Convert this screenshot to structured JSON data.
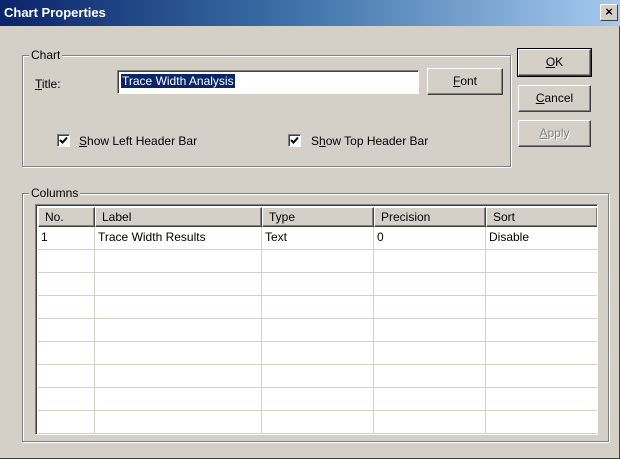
{
  "window": {
    "title": "Chart Properties",
    "close_glyph": "×"
  },
  "chart_group": {
    "label": "Chart",
    "title_label_prefix": "",
    "title_label_u": "T",
    "title_label_rest": "itle:",
    "title_value": "Trace Width Analysis",
    "font_button": {
      "u": "F",
      "rest": "ont"
    },
    "show_left_header_bar": {
      "checked": true,
      "u": "S",
      "rest": "how Left Header Bar"
    },
    "show_top_header_bar": {
      "checked": true,
      "pre": "S",
      "u": "h",
      "rest": "ow Top Header Bar"
    }
  },
  "buttons": {
    "ok": {
      "u": "O",
      "rest": "K"
    },
    "cancel": {
      "u": "C",
      "rest": "ancel"
    },
    "apply": {
      "u": "A",
      "rest": "pply",
      "disabled": true
    }
  },
  "columns_group": {
    "label": "Columns",
    "headers": [
      "No.",
      "Label",
      "Type",
      "Precision",
      "Sort"
    ],
    "rows": [
      [
        "1",
        "Trace Width Results",
        "Text",
        "0",
        "Disable"
      ],
      [
        "",
        "",
        "",
        "",
        ""
      ],
      [
        "",
        "",
        "",
        "",
        ""
      ],
      [
        "",
        "",
        "",
        "",
        ""
      ],
      [
        "",
        "",
        "",
        "",
        ""
      ],
      [
        "",
        "",
        "",
        "",
        ""
      ],
      [
        "",
        "",
        "",
        "",
        ""
      ],
      [
        "",
        "",
        "",
        "",
        ""
      ],
      [
        "",
        "",
        "",
        "",
        ""
      ]
    ]
  },
  "colors": {
    "face": "#d4d0c8",
    "title_gradient_start": "#0a246a",
    "title_gradient_end": "#a6caf0",
    "selection": "#0a246a"
  }
}
